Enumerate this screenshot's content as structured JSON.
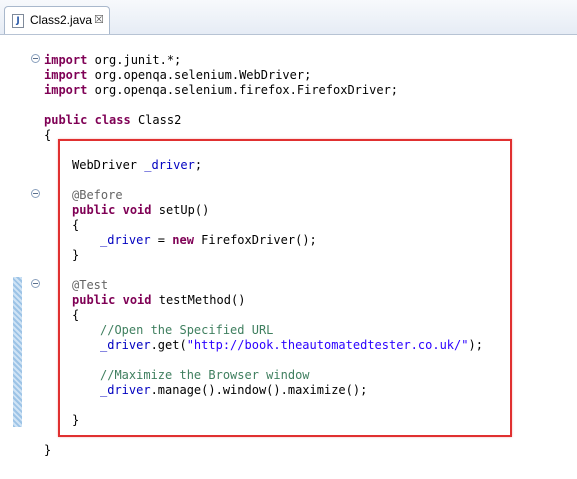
{
  "tab": {
    "title": "Class2.java",
    "icon": "java-file-icon",
    "close": "☒"
  },
  "code": {
    "l1": {
      "kw": "import",
      "rest": " org.junit.*;"
    },
    "l2": {
      "kw": "import",
      "rest": " org.openqa.selenium.WebDriver;"
    },
    "l3": {
      "kw": "import",
      "rest": " org.openqa.selenium.firefox.FirefoxDriver;"
    },
    "l5": {
      "kw1": "public",
      "kw2": "class",
      "rest": " Class2"
    },
    "l6": "{",
    "l8": {
      "type": "WebDriver ",
      "field": "_driver",
      "rest": ";"
    },
    "l10": "@Before",
    "l11": {
      "kw1": "public",
      "kw2": "void",
      "rest": " setUp()"
    },
    "l12": "{",
    "l13": {
      "field": "_driver",
      "mid": " = ",
      "kw": "new",
      "rest": " FirefoxDriver();"
    },
    "l14": "}",
    "l16": "@Test",
    "l17": {
      "kw1": "public",
      "kw2": "void",
      "rest": " testMethod()"
    },
    "l18": "{",
    "l19": "//Open the Specified URL",
    "l20": {
      "field": "_driver",
      "mid": ".get(",
      "str": "\"http://book.theautomatedtester.co.uk/\"",
      "rest": ");"
    },
    "l22": "//Maximize the Browser window",
    "l23": {
      "field": "_driver",
      "rest": ".manage().window().maximize();"
    },
    "l25": "}",
    "l27": "}"
  },
  "colors": {
    "keyword": "#7f0055",
    "annotation": "#646464",
    "field": "#0000c0",
    "comment": "#3f7f5f",
    "string": "#2a00ff",
    "highlight_border": "#e03030"
  }
}
